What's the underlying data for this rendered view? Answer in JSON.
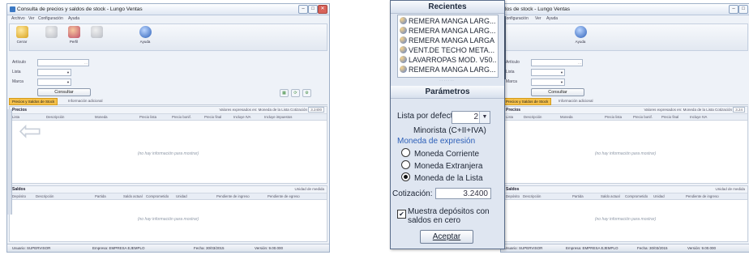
{
  "left": {
    "window_title": "Consulta de precios y saldos de stock - Lungo Ventas",
    "menu": [
      "Archivo",
      "Ver",
      "Configuración",
      "Ayuda"
    ],
    "ribbon": [
      {
        "label": "Cerrar",
        "icon": "door-icon"
      },
      {
        "label": "",
        "icon": "generic-icon"
      },
      {
        "label": "Perfil",
        "icon": "people-icon"
      },
      {
        "label": "",
        "icon": "generic-icon"
      },
      {
        "label": "Ayuda",
        "icon": "help-icon"
      }
    ],
    "filters": [
      {
        "label": "Artículo",
        "value": ""
      },
      {
        "label": "Lista",
        "value": ""
      },
      {
        "label": "Marca",
        "value": ""
      }
    ],
    "consultar_label": "Consultar",
    "tabs": [
      "Precios y Saldos de Stock",
      "Información adicional"
    ],
    "precios": {
      "title": "Precios",
      "right_text": "Valores expresados en: Moneda de la Lista  Cotización",
      "cotizacion": "3.2400",
      "columns": [
        "Lista",
        "Descripción",
        "Moneda",
        "Precio lista",
        "Precio bonif.",
        "Precio final",
        "Incluye IVA",
        "Incluye impuestos"
      ],
      "empty_text": "(no hay información para mostrar)"
    },
    "saldos": {
      "title": "Saldos",
      "right_text": "Unidad de medida",
      "columns": [
        "Depósito",
        "Descripción",
        "Partida",
        "Saldo actual",
        "Comprometido",
        "Unidad",
        "Pendiente de ingreso",
        "Pendiente de egreso"
      ],
      "empty_text": "(no hay información para mostrar)"
    },
    "status": [
      "Usuario: SUPERVISOR",
      "Empresa: EMPRESA EJEMPLO",
      "Fecha: 30/03/2015",
      "Versión: 9.00.000"
    ]
  },
  "popup": {
    "recientes_title": "Recientes",
    "recientes": [
      "REMERA MANGA LARG...",
      "REMERA MANGA LARG...",
      "REMERA MANGA LARGA",
      "VENT.DE TECHO META...",
      "LAVARROPAS MOD. V50...",
      "REMERA MANGA LARG..."
    ],
    "parametros_title": "Parámetros",
    "lista_label": "Lista por defecto:",
    "lista_value": "2",
    "lista_desc": "Minorista (C+II+IVA)",
    "moneda_title": "Moneda de expresión",
    "monedas": [
      "Moneda Corriente",
      "Moneda Extranjera",
      "Moneda de la Lista"
    ],
    "moneda_selected": 2,
    "cotizacion_label": "Cotización:",
    "cotizacion_value": "3.2400",
    "checkbox_label": "Muestra depósitos con saldos en cero",
    "checkbox_checked": true,
    "aceptar_label": "Aceptar"
  },
  "right": {
    "window_title": "dos de stock - Lungo Ventas",
    "menu": [
      "Configuración",
      "Ver",
      "Ayuda"
    ],
    "ribbon": [
      {
        "label": "Ayuda",
        "icon": "help-icon"
      }
    ],
    "filters": [
      {
        "label": "Artículo",
        "value": ""
      },
      {
        "label": "Lista",
        "value": ""
      },
      {
        "label": "Marca",
        "value": ""
      }
    ],
    "consultar_label": "Consultar",
    "tabs": [
      "Precios y Saldos de Stock",
      "Información adicional"
    ],
    "precios": {
      "title": "Precios",
      "right_text": "Valores expresados en: Moneda de la Lista  Cotización",
      "cotizacion": "3.24",
      "columns": [
        "Lista",
        "Descripción",
        "Moneda",
        "Precio lista",
        "Precio bonif.",
        "Precio final",
        "Incluye IVA"
      ],
      "empty_text": "(no hay información para mostrar)"
    },
    "saldos": {
      "title": "Saldos",
      "right_text": "Unidad de medida",
      "columns": [
        "Depósito",
        "Descripción",
        "Partida",
        "Saldo actual",
        "Comprometido",
        "Unidad",
        "Pendiente de ingreso"
      ],
      "empty_text": "(no hay información para mostrar)"
    },
    "status": [
      "Usuario: SUPERVISOR",
      "Empresa: EMPRESA EJEMPLO",
      "Fecha: 30/03/2015",
      "Versión: 9.00.000"
    ]
  }
}
